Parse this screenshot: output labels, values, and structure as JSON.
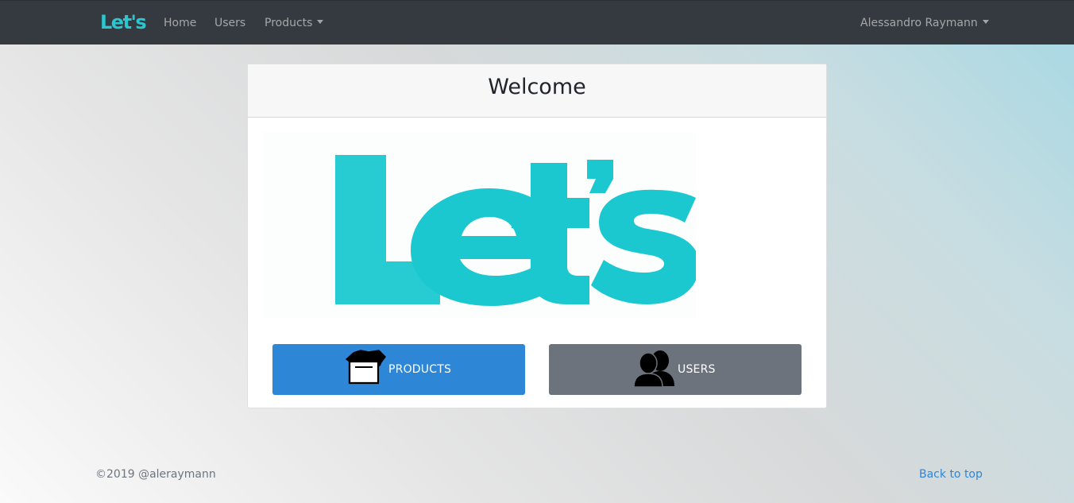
{
  "navbar": {
    "brand": "Let's",
    "links": [
      "Home",
      "Users",
      "Products"
    ],
    "user": "Alessandro Raymann"
  },
  "card": {
    "title": "Welcome",
    "logo_text": "Let's",
    "buttons": {
      "products": "PRODUCTS",
      "users": "USERS"
    }
  },
  "footer": {
    "copyright": "©2019 @aleraymann",
    "back_to_top": "Back to top"
  },
  "colors": {
    "navbar": "#343a40",
    "brand": "#2cc6cf",
    "primary": "#2e86d6",
    "secondary": "#6c737c"
  },
  "icons": {
    "products": "box-icon",
    "users": "users-icon"
  }
}
